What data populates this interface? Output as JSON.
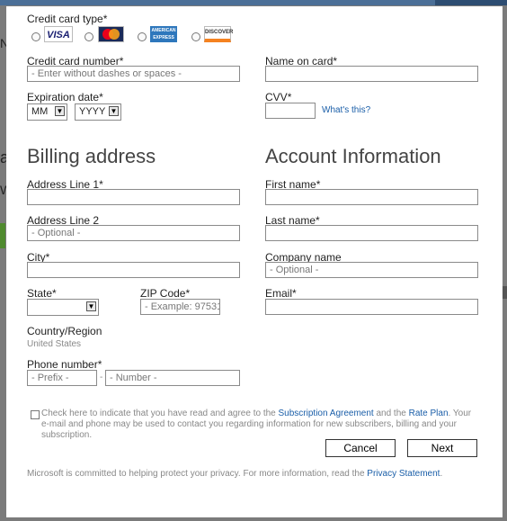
{
  "payment": {
    "card_type_label": "Credit card type",
    "cards": [
      {
        "name": "VISA",
        "color": "#1a1f71"
      },
      {
        "name": "MasterCard",
        "color": "#eb001b"
      },
      {
        "name": "AMERICAN EXPRESS",
        "color": "#2e77bc"
      },
      {
        "name": "DISCOVER",
        "color": "#f58220"
      }
    ],
    "card_number_label": "Credit card number",
    "card_number_placeholder": "- Enter without dashes or spaces -",
    "name_on_card_label": "Name on card",
    "expiration_label": "Expiration date",
    "month_value": "MM",
    "year_value": "YYYY",
    "cvv_label": "CVV",
    "whats_this": "What's this?"
  },
  "billing": {
    "heading": "Billing address",
    "address1_label": "Address Line 1",
    "address2_label": "Address Line 2",
    "address2_placeholder": "- Optional -",
    "city_label": "City",
    "state_label": "State",
    "zip_label": "ZIP Code",
    "zip_placeholder": "- Example: 97531 -",
    "country_label": "Country/Region",
    "country_value": "United States",
    "phone_label": "Phone number",
    "phone_prefix_placeholder": "- Prefix -",
    "phone_sep": "-",
    "phone_number_placeholder": "- Number -"
  },
  "account": {
    "heading": "Account Information",
    "first_name_label": "First name",
    "last_name_label": "Last name",
    "company_label": "Company name",
    "company_placeholder": "- Optional -",
    "email_label": "Email"
  },
  "agreement": {
    "text_before": "Check here to indicate that you have read and agree to the ",
    "subscription_link": "Subscription Agreement",
    "text_mid": " and the ",
    "rate_plan_link": "Rate Plan",
    "text_after": ". Your e-mail and phone may be used to contact you regarding information for new subscribers, billing and your subscription."
  },
  "buttons": {
    "cancel": "Cancel",
    "next": "Next"
  },
  "footer": {
    "privacy_text": "Microsoft is committed to helping protect your privacy. For more information, read the ",
    "privacy_link": "Privacy Statement",
    "privacy_end": "."
  },
  "backdrop": {
    "edge_letters": [
      "N",
      "a",
      "W"
    ]
  }
}
